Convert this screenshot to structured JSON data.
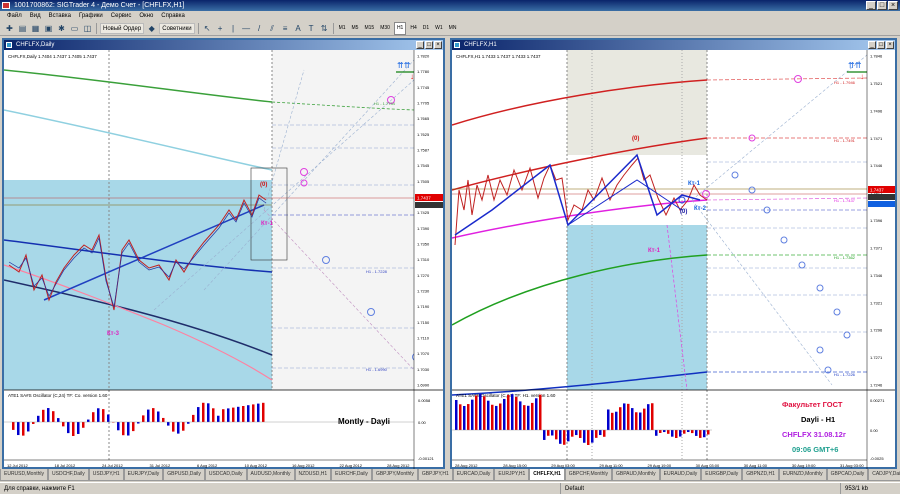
{
  "window": {
    "title": "1001700862: SIGTrader 4 - Демо Счет - [CHFLFX,H1]"
  },
  "menu": [
    "Файл",
    "Вид",
    "Вставка",
    "Графики",
    "Сервис",
    "Окно",
    "Справка"
  ],
  "toolbar": {
    "new_order": "Новый Ордер",
    "advisors": "Советники",
    "timeframes": [
      "M1",
      "M5",
      "M15",
      "M30",
      "H1",
      "H4",
      "D1",
      "W1",
      "MN"
    ],
    "active_tf": "H1"
  },
  "left": {
    "window_title": "CHFLFX,Daily",
    "info": "CHFLFX,Daily  1.7404 1.7437 1.7405 1.7437",
    "osc_label": "ATE1 SA#S Oscillator (C,24) TF: Co. version 1.60",
    "caption": "Montly - Dayli",
    "labels": {
      "kt1": "Кт-1",
      "kt3": "Кт-3",
      "zero": "(0)"
    },
    "prices": [
      "1.7820",
      "1.7780",
      "1.7745",
      "1.7705",
      "1.7665",
      "1.7625",
      "1.7587",
      "1.7545",
      "1.7505",
      "1.7465",
      "1.7425",
      "1.7390",
      "1.7350",
      "1.7310",
      "1.7270",
      "1.7230",
      "1.7190",
      "1.7150",
      "1.7110",
      "1.7070",
      "1.7030",
      "1.6990"
    ],
    "osc_prices": [
      "0.0058",
      "0.00",
      "-0.00121"
    ],
    "dates": [
      "12 Jul 2012",
      "18 Jul 2012",
      "24 Jul 2012",
      "31 Jul 2012",
      "6 Aug 2012",
      "10 Aug 2012",
      "16 Aug 2012",
      "22 Aug 2012",
      "28 Aug 2012"
    ],
    "current_price": "1.7437",
    "level_labels": [
      "H1 - 1.7754",
      "H1 - 1.7228",
      "H1 - 1.6990"
    ]
  },
  "right": {
    "window_title": "CHFLFX,H1",
    "info": "CHFLFX,H1  1.7433 1.7437 1.7433 1.7437",
    "osc_label": "ATE1 SA#S Oscillator (C,24) TF: H1. version 1.60",
    "labels": {
      "kt1a": "Кт-1",
      "kt1b": "Кт-1",
      "kt2": "Кт-2",
      "zero": "(0)",
      "zero2": "(0)"
    },
    "prices": [
      "1.7846",
      "1.7521",
      "1.7496",
      "1.7471",
      "1.7446",
      "1.7421",
      "1.7396",
      "1.7371",
      "1.7346",
      "1.7321",
      "1.7296",
      "1.7271",
      "1.7246"
    ],
    "osc_prices": [
      "0.00271",
      "0.00",
      "-0.0025"
    ],
    "dates": [
      "28 Aug 2012",
      "28 Aug 15:00",
      "29 Aug 03:00",
      "29 Aug 11:00",
      "29 Aug 19:00",
      "30 Aug 03:00",
      "30 Aug 11:00",
      "30 Aug 19:00",
      "31 Aug 03:00"
    ],
    "current_price": "1.7437",
    "level_labels": [
      "H1 - 1.7946",
      "H1 - 1.7491",
      "H1 - 1.7437",
      "H1 - 1.7362",
      "H1 - 1.7226"
    ],
    "info_lines": {
      "faculty": "Факультет ГОСТ",
      "timeframe": "Dayli - H1",
      "symbol_date": "CHFLFX 31.08.12г",
      "time": "09:06 GMT+6"
    }
  },
  "tabs": [
    "EURUSD,Monthly",
    "USDCHF,Daily",
    "USDJPY,H1",
    "EURJPY,Daily",
    "GBPUSD,Daily",
    "USDCAD,Daily",
    "AUDUSD,Monthly",
    "NZDUSD,H1",
    "EURCHF,Daily",
    "GBPJPY,Monthly",
    "GBPJPY,H1",
    "EURCAD,Daily",
    "EURJPY,H1",
    "CHFLFX,H1",
    "GBPCHF,Monthly",
    "GBPAUD,Monthly",
    "EURAUD,Daily",
    "EURGBP,Daily",
    "GBPNZD,H1",
    "EURNZD,Monthly",
    "GBPCAD,Daily",
    "CADJPY,Daily"
  ],
  "active_tab": "CHFLFX,H1",
  "status": {
    "help": "Для справки, нажмите F1",
    "profile": "Default",
    "traffic": "953/1 kb"
  },
  "colors": {
    "zone_blue": "#a8d8e8",
    "bull": "#e00000",
    "bear": "#0000cc"
  }
}
